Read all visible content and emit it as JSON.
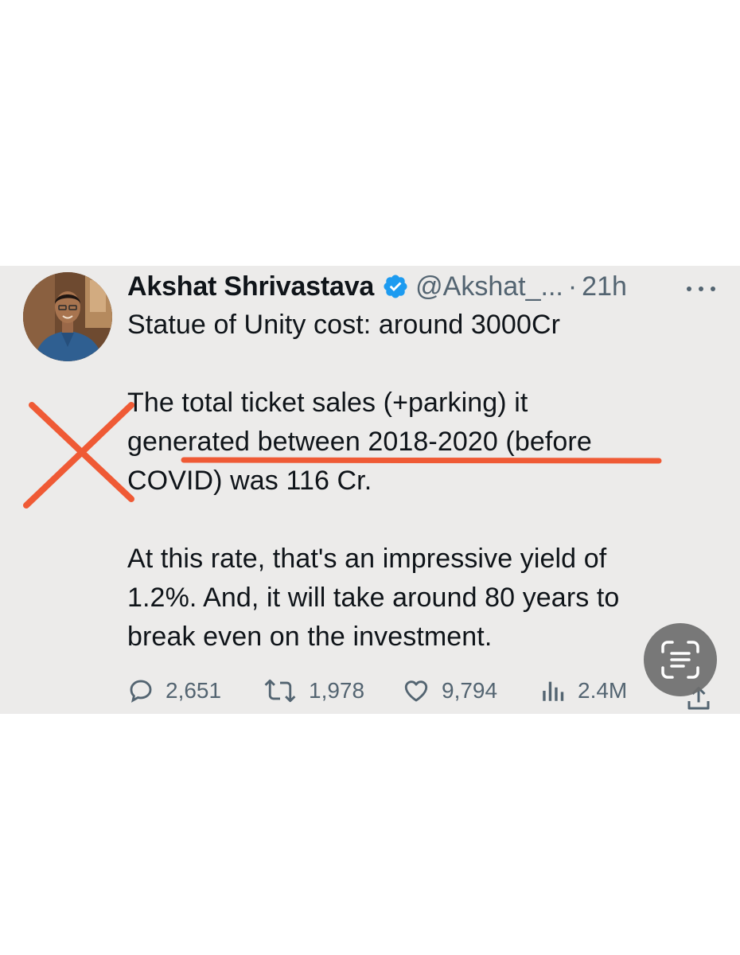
{
  "tweet": {
    "author_name": "Akshat Shrivastava",
    "handle": "@Akshat_...",
    "separator": "·",
    "time": "21h",
    "verified_icon": "verified-badge-icon",
    "more_icon": "more-options-icon",
    "paragraphs": [
      "Statue of Unity cost: around 3000Cr",
      "The total ticket sales (+parking) it\ngenerated between 2018-2020 (before\nCOVID) was 116 Cr.",
      "At this rate, that's an impressive yield of\n1.2%. And, it will take around 80 years to\nbreak even on the investment."
    ]
  },
  "actions": {
    "reply": {
      "icon": "reply-icon",
      "count": "2,651"
    },
    "retweet": {
      "icon": "retweet-icon",
      "count": "1,978"
    },
    "like": {
      "icon": "like-icon",
      "count": "9,794"
    },
    "views": {
      "icon": "views-icon",
      "count": "2.4M"
    },
    "share": {
      "icon": "share-icon"
    }
  },
  "overlay": {
    "scan_text_icon": "scan-text-icon",
    "annotation_color": "#ef5a35"
  },
  "colors": {
    "card_background": "#ecebea",
    "text_primary": "#0f1419",
    "text_secondary": "#536471",
    "verified_blue": "#1d9bf0"
  }
}
